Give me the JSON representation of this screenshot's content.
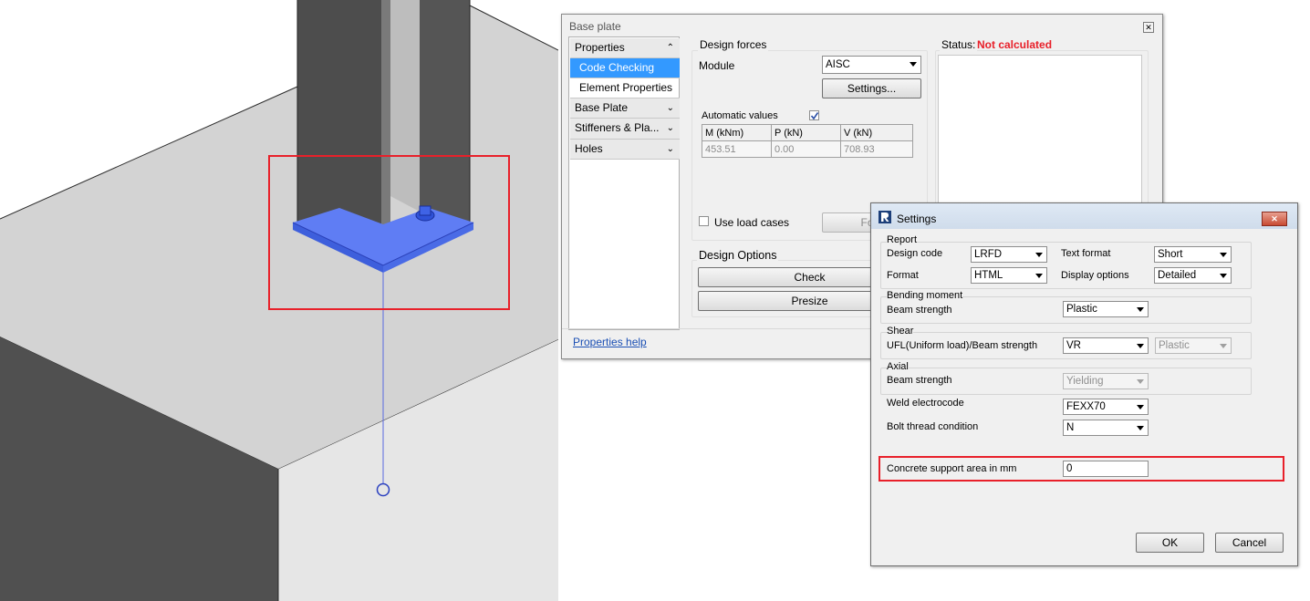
{
  "colors": {
    "accent": "#3399ff",
    "status_red": "#e8202a",
    "link": "#1a4fb4",
    "highlight_box": "#e8202a",
    "selected_base_plate": "#5f7df4"
  },
  "base_plate_dialog": {
    "title": "Base plate",
    "close_icon": "close-icon",
    "nav": [
      {
        "label": "Properties",
        "icon": "chevron-up-icon"
      },
      {
        "label": "Code Checking",
        "icon": ""
      },
      {
        "label": "Element Properties",
        "icon": ""
      },
      {
        "label": "Base Plate",
        "icon": "chevron-down-icon"
      },
      {
        "label": "Stiffeners & Pla...",
        "icon": "chevron-down-icon"
      },
      {
        "label": "Holes",
        "icon": "chevron-down-icon"
      }
    ],
    "properties_help": "Properties help",
    "design_forces": {
      "title": "Design forces",
      "module_label": "Module",
      "module_value": "AISC",
      "settings_button": "Settings...",
      "automatic_values_label": "Automatic values",
      "automatic_values_checked": true,
      "table": {
        "headers": [
          "M (kNm)",
          "P (kN)",
          "V (kN)"
        ],
        "row": [
          "453.51",
          "0.00",
          "708.93"
        ]
      },
      "use_load_cases_label": "Use load cases",
      "use_load_cases_checked": false,
      "forces_button": "Forc"
    },
    "status": {
      "label": "Status:",
      "value": "Not calculated"
    },
    "design_options": {
      "title": "Design Options",
      "check_button": "Check",
      "presize_button": "Presize"
    }
  },
  "settings_dialog": {
    "title": "Settings",
    "app_icon": "revit-logo-icon",
    "close_icon": "close-icon",
    "report": {
      "title": "Report",
      "design_code_label": "Design code",
      "design_code_value": "LRFD",
      "text_format_label": "Text format",
      "text_format_value": "Short",
      "format_label": "Format",
      "format_value": "HTML",
      "display_options_label": "Display options",
      "display_options_value": "Detailed"
    },
    "bending": {
      "title": "Bending moment",
      "beam_strength_label": "Beam strength",
      "beam_strength_value": "Plastic"
    },
    "shear": {
      "title": "Shear",
      "ufl_label": "UFL(Uniform load)/Beam strength",
      "ufl_value": "VR",
      "ufl_second_value": "Plastic"
    },
    "axial": {
      "title": "Axial",
      "beam_strength_label": "Beam strength",
      "beam_strength_value": "Yielding"
    },
    "weld_label": "Weld electrocode",
    "weld_value": "FEXX70",
    "bolt_label": "Bolt thread condition",
    "bolt_value": "N",
    "concrete_label": "Concrete support area in mm",
    "concrete_value": "0",
    "ok_button": "OK",
    "cancel_button": "Cancel"
  }
}
